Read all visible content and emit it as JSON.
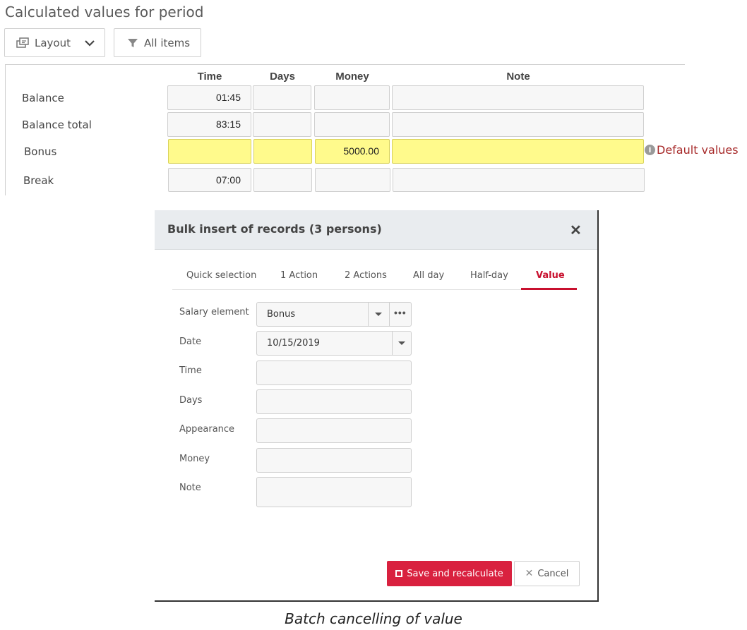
{
  "header": {
    "title": "Calculated values for period",
    "layout_label": "Layout",
    "items_label": "All items"
  },
  "table": {
    "columns": [
      "Time",
      "Days",
      "Money",
      "Note"
    ],
    "rows": [
      {
        "label": "Balance",
        "time": "01:45",
        "days": "",
        "money": "",
        "note": ""
      },
      {
        "label": "Balance total",
        "time": "83:15",
        "days": "",
        "money": "",
        "note": ""
      },
      {
        "label": "Bonus",
        "time": "",
        "days": "",
        "money": "5000.00",
        "note": ""
      },
      {
        "label": "Break",
        "time": "07:00",
        "days": "",
        "money": "",
        "note": ""
      }
    ],
    "default_values_note": "Default values",
    "highlight_color": "#fffa8c"
  },
  "dialog": {
    "title": "Bulk insert of records (3 persons)",
    "tabs": [
      "Quick selection",
      "1 Action",
      "2 Actions",
      "All day",
      "Half-day",
      "Value"
    ],
    "active_tab": "Value",
    "fields": {
      "salary_element": {
        "label": "Salary element",
        "value": "Bonus"
      },
      "date": {
        "label": "Date",
        "value": "10/15/2019"
      },
      "time": {
        "label": "Time",
        "value": ""
      },
      "days": {
        "label": "Days",
        "value": ""
      },
      "appearance": {
        "label": "Appearance",
        "value": ""
      },
      "money": {
        "label": "Money",
        "value": ""
      },
      "note": {
        "label": "Note",
        "value": ""
      }
    },
    "save_label": "Save and recalculate",
    "cancel_label": "Cancel",
    "accent_color": "#c8102e"
  },
  "caption": "Batch cancelling of value"
}
